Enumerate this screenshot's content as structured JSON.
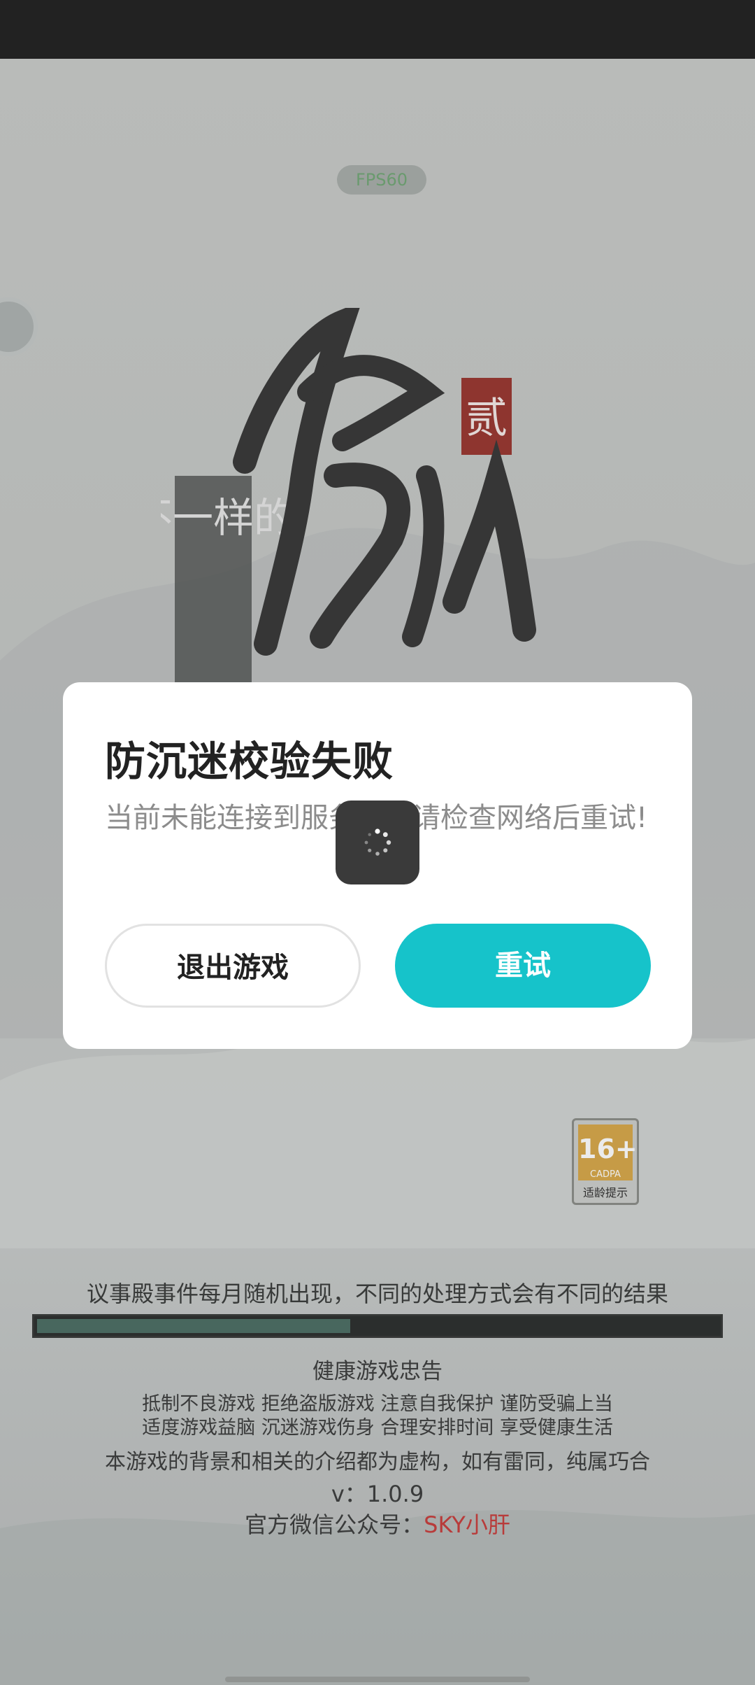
{
  "colors": {
    "status_bar": "#252525",
    "accent_button": "#16c3ca",
    "highlight_text": "#c8413f",
    "progress_fill": "#4f7066"
  },
  "top": {
    "fps_text": "FPS60"
  },
  "logo": {
    "text_small": "不一样的",
    "seal": "贰",
    "brush_text": "修仙"
  },
  "age_rating": {
    "label": "16+",
    "brand": "CADPA",
    "caption": "适龄提示"
  },
  "loading": {
    "tip": "议事殿事件每月随机出现，不同的处理方式会有不同的结果",
    "progress": 0.46
  },
  "health": {
    "title": "健康游戏忠告",
    "line1": "抵制不良游戏  拒绝盗版游戏  注意自我保护  谨防受骗上当",
    "line2": "适度游戏益脑  沉迷游戏伤身  合理安排时间  享受健康生活"
  },
  "footer": {
    "disclaimer": "本游戏的背景和相关的介绍都为虚构，如有雷同，纯属巧合",
    "version": "v：1.0.9",
    "official_prefix": "官方微信公众号：",
    "official_name": "SKY小肝"
  },
  "dialog": {
    "title": "防沉迷校验失败",
    "message": "当前未能连接到服务器，请检查网络后重试!",
    "quit_label": "退出游戏",
    "retry_label": "重试"
  }
}
